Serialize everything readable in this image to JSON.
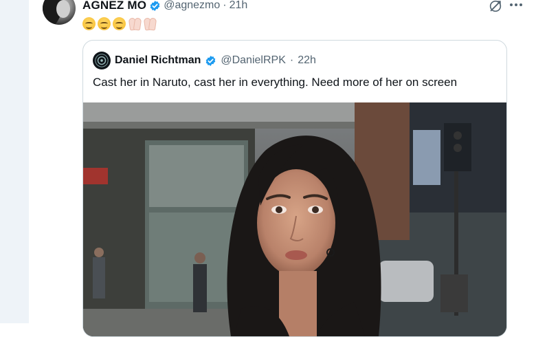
{
  "tweet": {
    "display_name": "AGNEZ MO",
    "handle": "@agnezmo",
    "separator": "·",
    "time": "21h",
    "emoji_text": "😌😌☺️🙏🏻🙏🏻"
  },
  "quoted": {
    "display_name": "Daniel Richtman",
    "handle": "@DanielRPK",
    "separator": "·",
    "time": "22h",
    "text": "Cast her in Naruto, cast her in everything. Need more of her on screen"
  },
  "colors": {
    "verified": "#1d9bf0",
    "secondary_text": "#536471",
    "rail": "#eef3f8"
  },
  "icons": {
    "verified": "verified-badge-icon",
    "grok": "grok-icon",
    "more": "more-options-icon"
  }
}
